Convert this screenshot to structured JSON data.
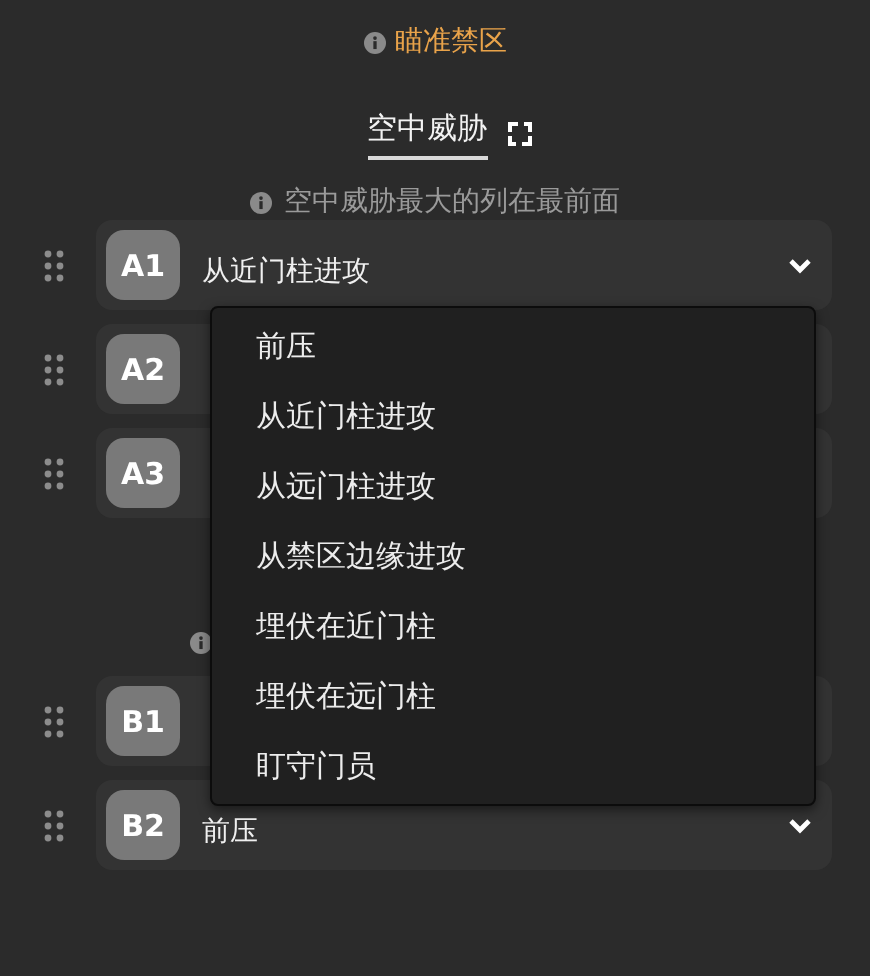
{
  "title": "瞄准禁区",
  "tabs": [
    {
      "label": "空中威胁",
      "selected": true
    }
  ],
  "hint": "空中威胁最大的列在最前面",
  "groups": [
    {
      "header": false,
      "rows": [
        {
          "badge": "A1",
          "value": "从近门柱进攻",
          "chevron": true
        },
        {
          "badge": "A2"
        },
        {
          "badge": "A3"
        }
      ]
    },
    {
      "header": true,
      "rows": [
        {
          "badge": "B1"
        },
        {
          "badge": "B2",
          "value": "前压",
          "chevron": true
        }
      ]
    }
  ],
  "dropdown": {
    "items": [
      "前压",
      "从近门柱进攻",
      "从远门柱进攻",
      "从禁区边缘进攻",
      "埋伏在近门柱",
      "埋伏在远门柱",
      "盯守门员"
    ]
  }
}
